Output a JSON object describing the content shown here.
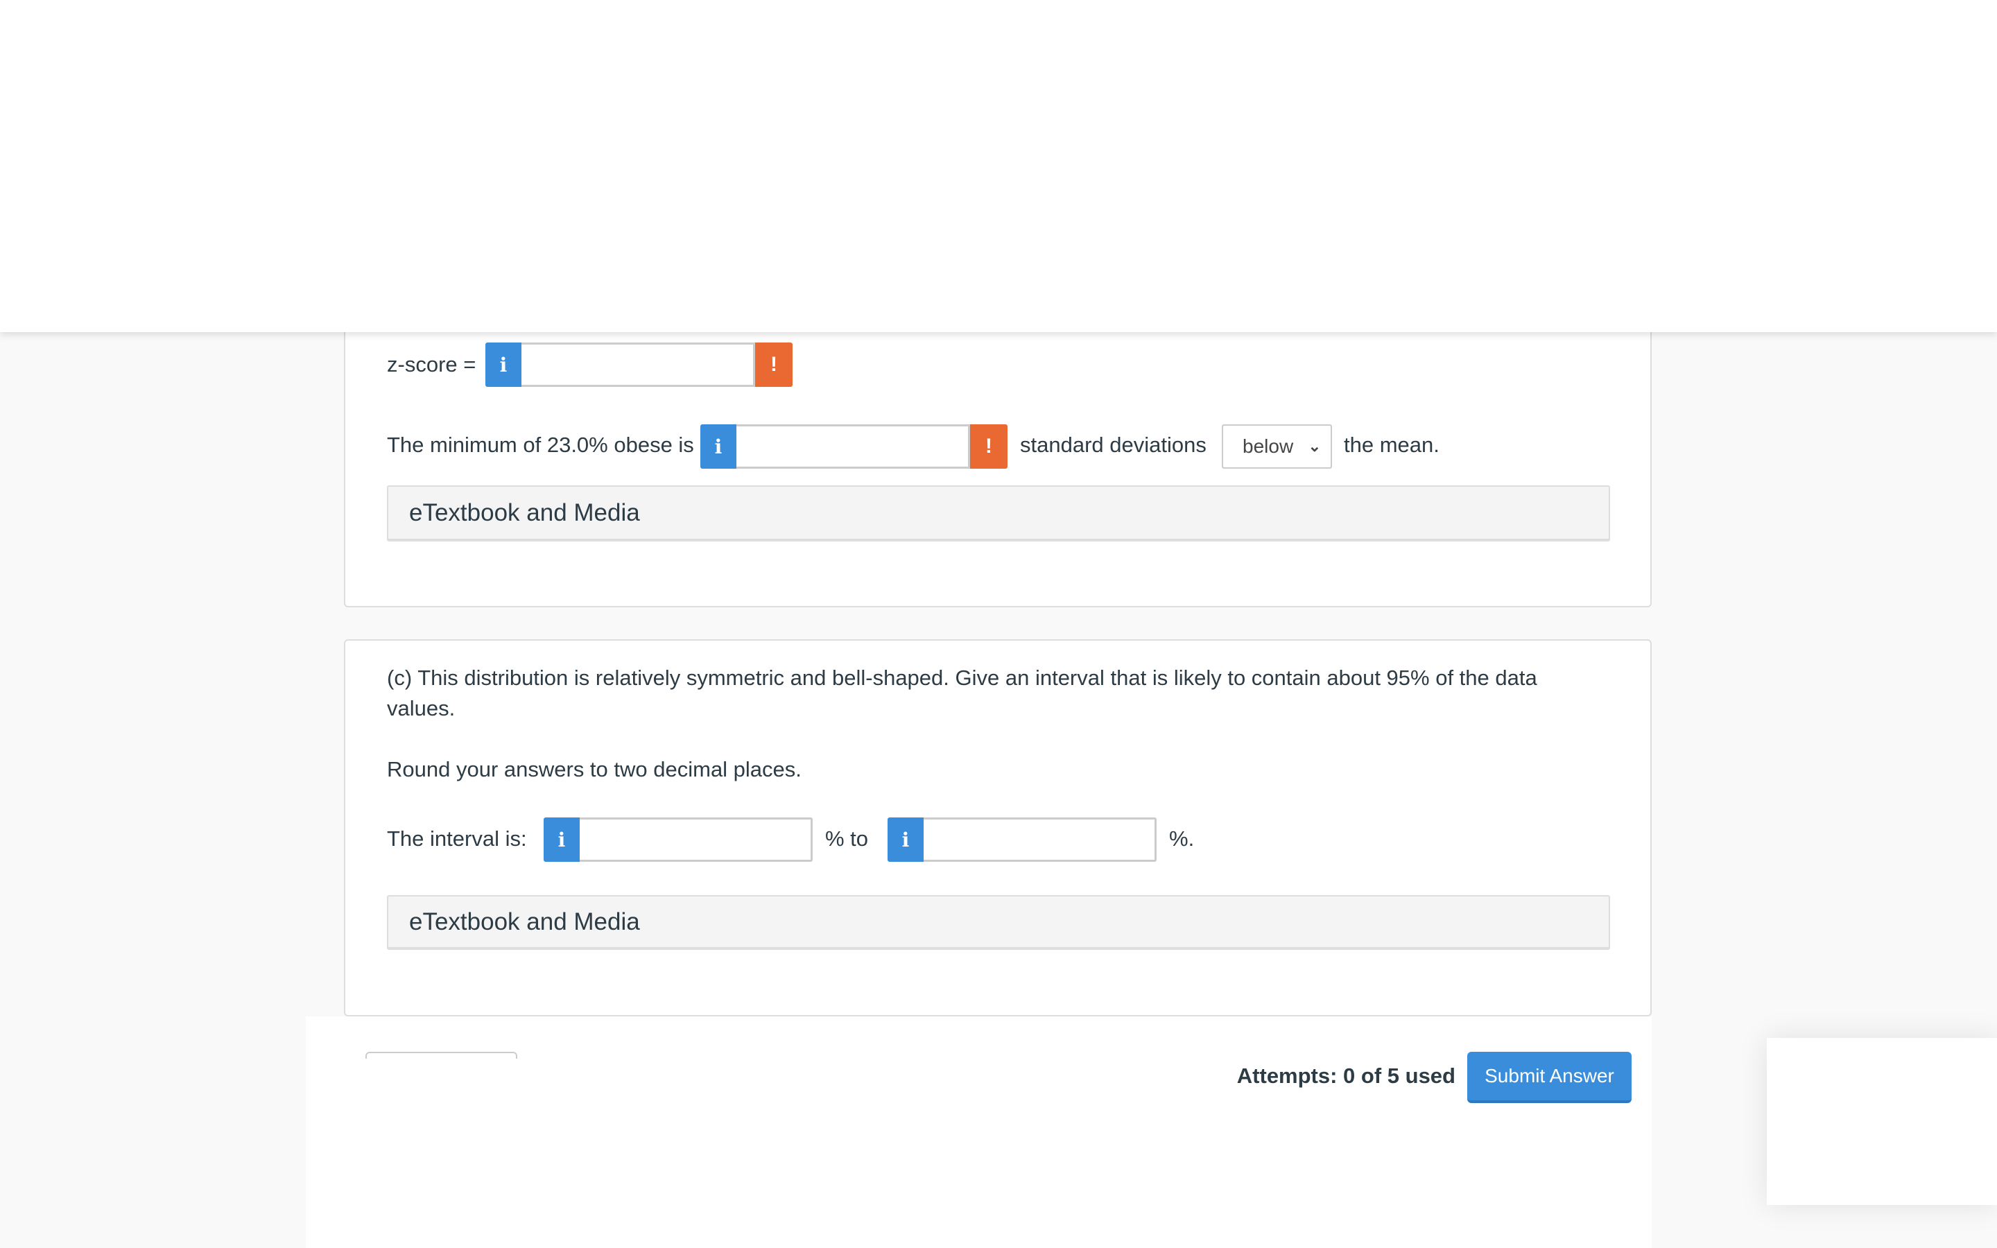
{
  "part_b": {
    "zscore_label": "z-score =",
    "minimum_label": "The minimum of 23.0% obese is",
    "std_label": "standard deviations",
    "direction_selected": "below",
    "mean_label": "the mean.",
    "etextbook": "eTextbook and Media"
  },
  "part_c": {
    "question_line1": "(c) This distribution is relatively symmetric and bell-shaped. Give an interval that is likely to contain about 95% of the data",
    "question_line2": "values.",
    "instruction": "Round your answers to two decimal places.",
    "interval_label": "The interval is:",
    "to_label": "% to",
    "end_label": "%.",
    "etextbook": "eTextbook and Media"
  },
  "icons": {
    "info": "i",
    "warning": "!",
    "chevron": "⌄"
  },
  "footer": {
    "attempts": "Attempts: 0 of 5 used",
    "submit_label": "Submit Answer"
  },
  "colors": {
    "info": "#3a8ddb",
    "warning": "#ea6831",
    "submit": "#3a8ddb"
  }
}
